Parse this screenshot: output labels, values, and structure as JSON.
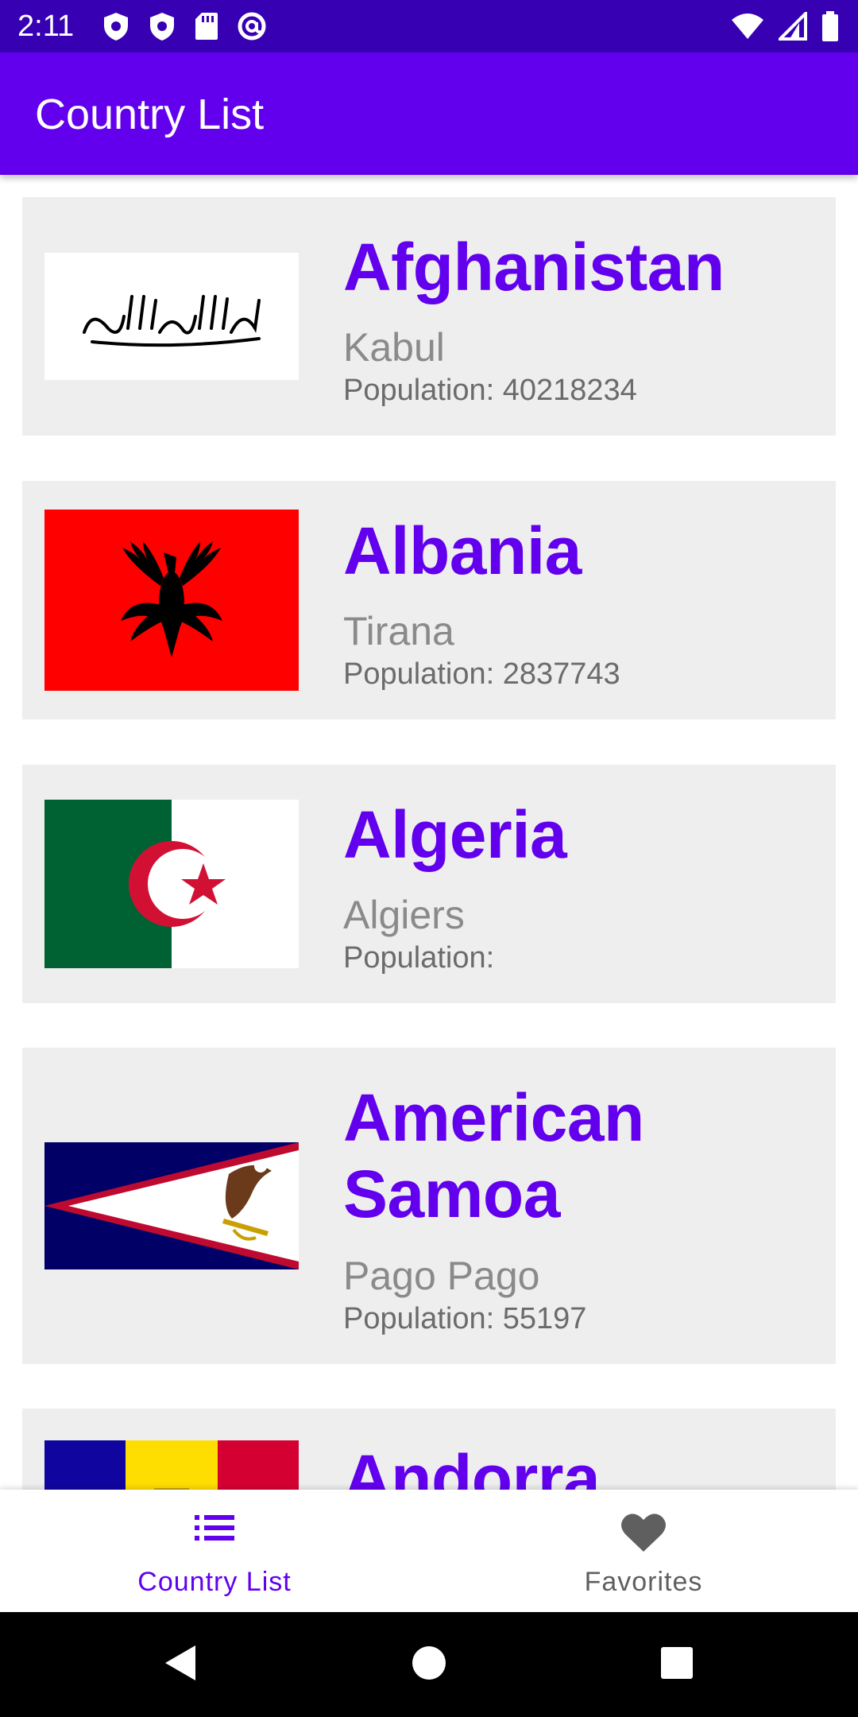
{
  "status_bar": {
    "time": "2:11",
    "icons_left": [
      "shield-icon",
      "shield-icon",
      "sd-card-icon",
      "at-sign-icon"
    ],
    "icons_right": [
      "wifi-icon",
      "signal-icon",
      "battery-icon"
    ]
  },
  "app_bar": {
    "title": "Country List"
  },
  "countries": [
    {
      "name": "Afghanistan",
      "capital": "Kabul",
      "population_label": "Population:",
      "population": "40218234",
      "flag": "afghanistan-flag"
    },
    {
      "name": "Albania",
      "capital": "Tirana",
      "population_label": "Population:",
      "population": "2837743",
      "flag": "albania-flag"
    },
    {
      "name": "Algeria",
      "capital": "Algiers",
      "population_label": "Population:",
      "population": "",
      "flag": "algeria-flag"
    },
    {
      "name": "American Samoa",
      "capital": "Pago Pago",
      "population_label": "Population:",
      "population": "55197",
      "flag": "american-samoa-flag"
    },
    {
      "name": "Andorra",
      "capital": "",
      "population_label": "",
      "population": "",
      "flag": "andorra-flag"
    }
  ],
  "bottom_nav": {
    "items": [
      {
        "label": "Country List",
        "icon": "list-icon",
        "active": true
      },
      {
        "label": "Favorites",
        "icon": "heart-icon",
        "active": false
      }
    ]
  },
  "colors": {
    "status_bar": "#3700b3",
    "app_bar": "#6200ee",
    "accent": "#6200ee",
    "card_background": "#eeeeee",
    "capital_text": "#8a8a8a",
    "population_text": "#6b6b6b"
  },
  "system_nav": {
    "buttons": [
      "back-icon",
      "home-icon",
      "recents-icon"
    ]
  }
}
